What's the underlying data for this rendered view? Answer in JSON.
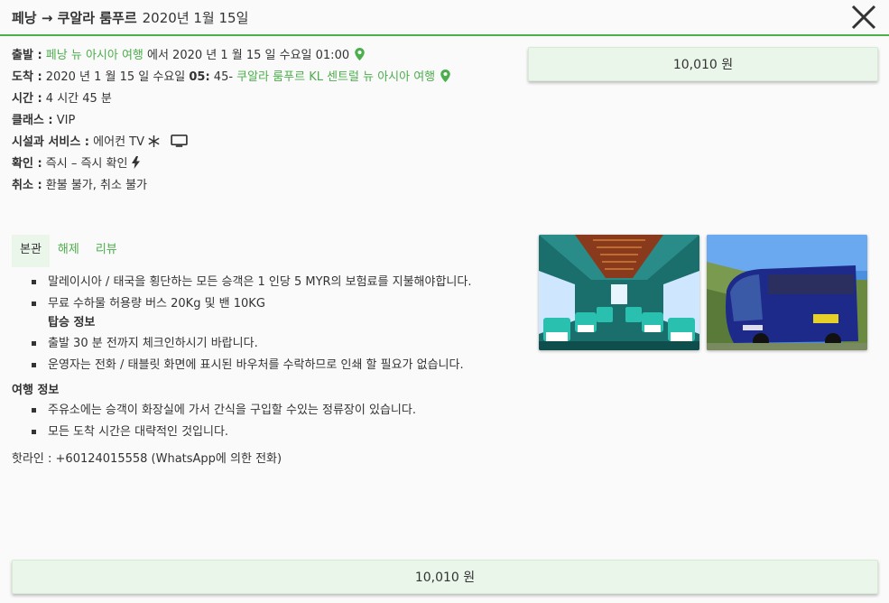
{
  "header": {
    "route": "페낭 → 쿠알라 룸푸르",
    "date": "2020년 1월 15일"
  },
  "details": {
    "departure_label": "출발 :",
    "departure_place": "페낭 뉴 아시아 여행",
    "departure_text": " 에서 2020 년 1 월 15 일 수요일 01:00",
    "arrival_label": "도착 :",
    "arrival_text": " 2020 년 1 월 15 일 수요일 ",
    "arrival_hour": "05:",
    "arrival_min": " 45- ",
    "arrival_place": "쿠알라 룸푸르 KL 센트럴 뉴 아시아 여행",
    "duration_label": "시간 :",
    "duration_value": " 4 시간 45 분",
    "class_label": "클래스 :",
    "class_value": " VIP",
    "facilities_label": "시설과 서비스 :",
    "facilities_value": " 에어컨 TV",
    "confirm_label": "확인 :",
    "confirm_value": " 즉시 – 즉시 확인",
    "cancel_label": "취소 :",
    "cancel_value": " 환불 불가, 취소 불가"
  },
  "price": {
    "top": "10,010 원",
    "bottom": "10,010 원"
  },
  "tabs": [
    {
      "label": "본관",
      "active": true
    },
    {
      "label": "해제",
      "active": false
    },
    {
      "label": "리뷰",
      "active": false
    }
  ],
  "content": {
    "bullets1": [
      "말레이시아 / 태국을 횡단하는 모든 승객은 1 인당 5 MYR의 보험료를 지불해야합니다.",
      "무료 수하물 허용량 버스 20Kg 및 밴 10KG"
    ],
    "boarding_title": "탑승 정보",
    "bullets2": [
      "출발 30 분 전까지 체크인하시기 바랍니다.",
      "운영자는 전화 / 태블릿 화면에 표시된 바우처를 수락하므로 인쇄 할 필요가 없습니다."
    ],
    "travel_title": "여행 정보",
    "bullets3": [
      "주유소에는 승객이 화장실에 가서 간식을 구입할 수있는 정류장이 있습니다.",
      "모든 도착 시간은 대략적인 것입니다."
    ],
    "hotline": "핫라인 : +60124015558 (WhatsApp에 의한 전화)"
  },
  "colors": {
    "accent": "#4cae4c",
    "price_bg": "#eaf6ea"
  }
}
